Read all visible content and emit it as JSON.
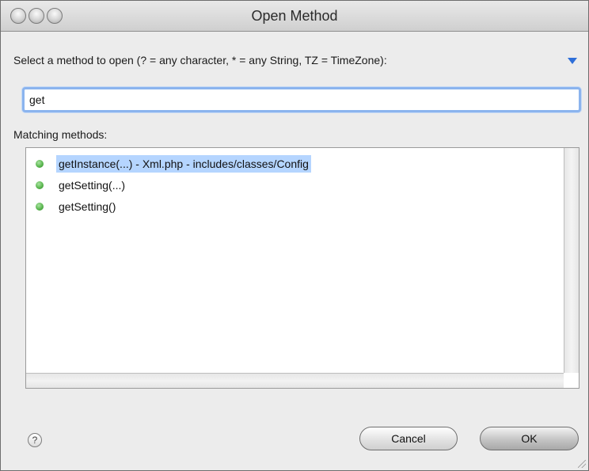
{
  "window": {
    "title": "Open Method"
  },
  "prompt": "Select a method to open (? = any character, * = any String, TZ = TimeZone):",
  "search": {
    "value": "get"
  },
  "matching_label": "Matching methods:",
  "methods": [
    {
      "label": "getInstance(...) - Xml.php - includes/classes/Config",
      "selected": true,
      "icon": "green-dot-icon"
    },
    {
      "label": "getSetting(...)",
      "selected": false,
      "icon": "green-dot-icon"
    },
    {
      "label": "getSetting()",
      "selected": false,
      "icon": "green-dot-icon"
    }
  ],
  "help": {
    "symbol": "?"
  },
  "buttons": {
    "cancel": "Cancel",
    "ok": "OK"
  },
  "colors": {
    "selection": "#b5d5ff",
    "focus_ring": "#8bb4ee",
    "disclosure": "#2e6fd9",
    "method_dot": "#55b24a"
  }
}
